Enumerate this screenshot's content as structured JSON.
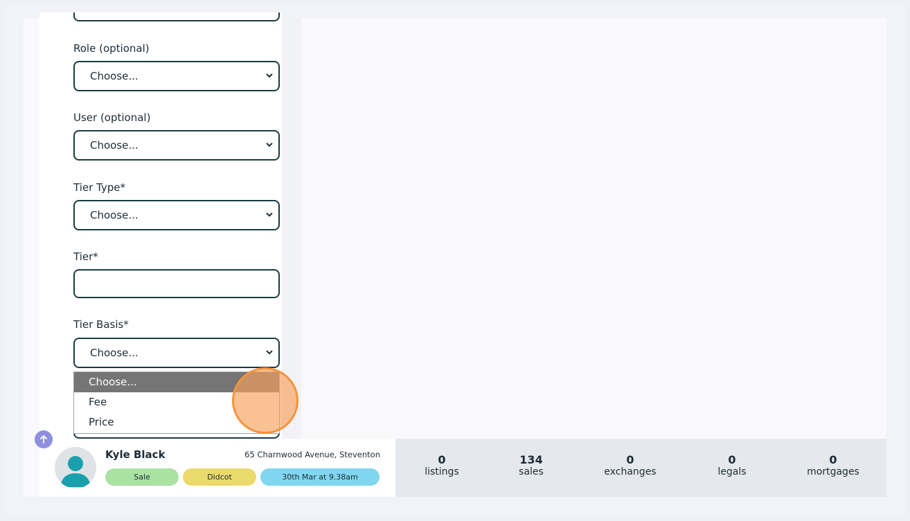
{
  "form": {
    "role_label": "Role (optional)",
    "role_value": "Choose...",
    "user_label": "User (optional)",
    "user_value": "Choose...",
    "tier_type_label": "Tier Type*",
    "tier_type_value": "Choose...",
    "tier_label": "Tier*",
    "tier_value": "",
    "tier_basis_label": "Tier Basis*",
    "tier_basis_value": "Choose...",
    "tier_basis_options": [
      "Choose...",
      "Fee",
      "Price"
    ],
    "tier_basis_highlighted": "Choose..."
  },
  "footer": {
    "name": "Kyle Black",
    "address": "65 Charnwood Avenue, Steventon",
    "badges": {
      "type": "Sale",
      "location": "Didcot",
      "date": "30th Mar at 9.38am"
    },
    "colors": {
      "sale": "#a9e2a1",
      "location": "#ead96b",
      "date": "#7fd6ee"
    }
  },
  "stats": [
    {
      "value": "0",
      "label": "listings"
    },
    {
      "value": "134",
      "label": "sales"
    },
    {
      "value": "0",
      "label": "exchanges"
    },
    {
      "value": "0",
      "label": "legals"
    },
    {
      "value": "0",
      "label": "mortgages"
    }
  ],
  "icons": {
    "scroll_top": "arrow-up-icon",
    "avatar": "user-avatar-icon",
    "select": "chevron-down-icon"
  },
  "accent": "#183a3f"
}
